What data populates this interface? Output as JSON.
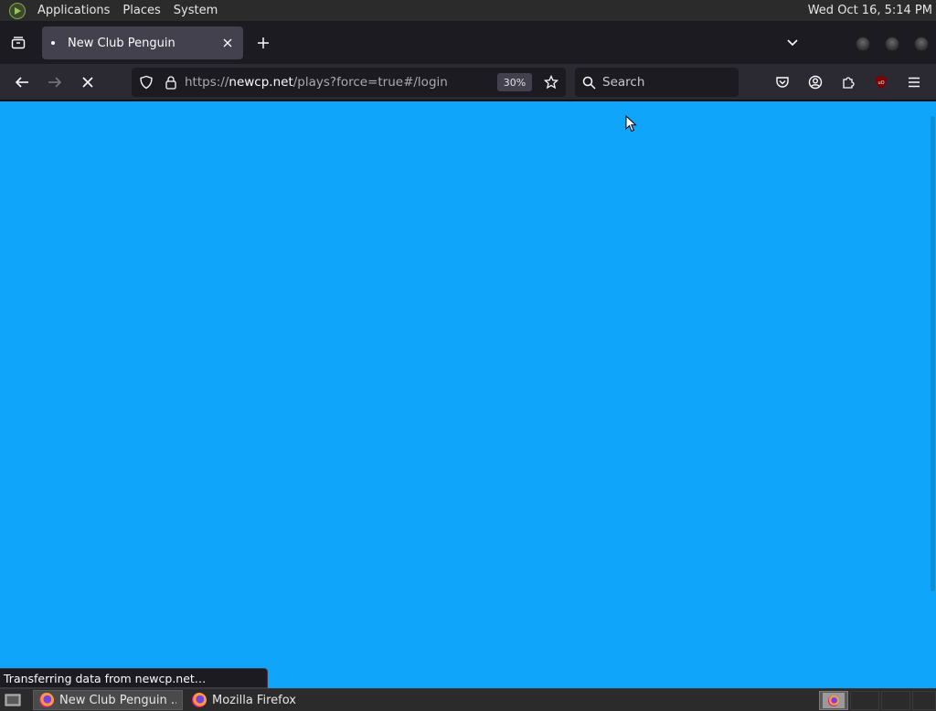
{
  "panel": {
    "menus": [
      "Applications",
      "Places",
      "System"
    ],
    "clock": "Wed Oct 16,  5:14 PM"
  },
  "browser": {
    "tab": {
      "title": "New Club Penguin"
    },
    "url": {
      "scheme": "https://",
      "host": "newcp.net",
      "path": "/plays?force=true#/login"
    },
    "zoom": "30%",
    "search": {
      "placeholder": "Search"
    },
    "status_text": "Transferring data from newcp.net…",
    "content_color": "#0ea5fa"
  },
  "taskbar": {
    "tasks": [
      {
        "label": "New Club Penguin ...",
        "icon": "firefox-icon",
        "active": true
      },
      {
        "label": "Mozilla Firefox",
        "icon": "firefox-icon",
        "active": false
      }
    ]
  },
  "icons": {
    "panel_logo": "distro-logo-icon",
    "list_tabs": "list-all-tabs-icon",
    "tab_close": "close-icon",
    "new_tab": "plus-icon",
    "tab_overflow": "chevron-down-icon",
    "back": "arrow-left-icon",
    "forward": "arrow-right-icon",
    "stop": "stop-x-icon",
    "tracking": "shield-icon",
    "security": "lock-icon",
    "bookmark": "star-icon",
    "search": "magnifier-icon",
    "pocket": "pocket-icon",
    "account": "account-icon",
    "extensions": "puzzle-icon",
    "ublock": "ublock-origin-icon",
    "menu": "hamburger-icon"
  }
}
